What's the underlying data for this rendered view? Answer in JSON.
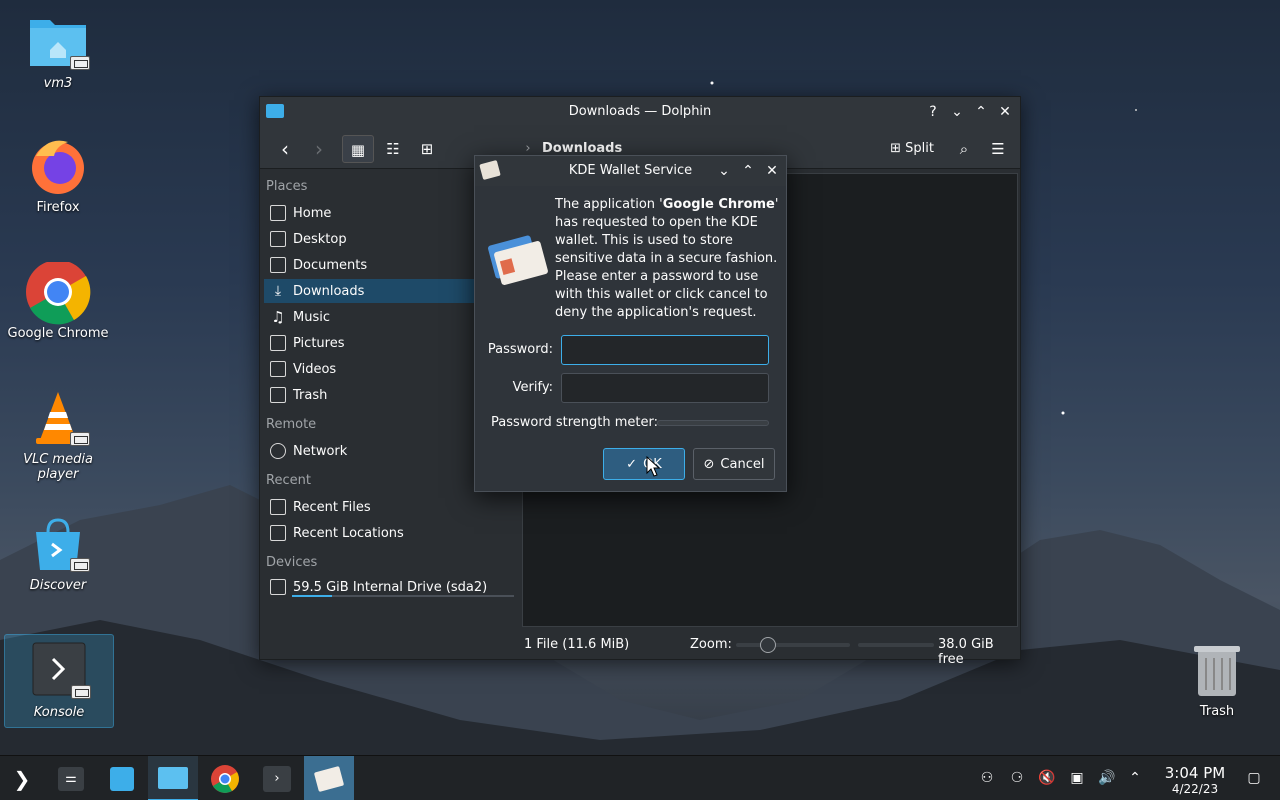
{
  "desktop": {
    "icons": [
      {
        "label": "vm3"
      },
      {
        "label": "Firefox"
      },
      {
        "label": "Google Chrome"
      },
      {
        "label": "VLC media player"
      },
      {
        "label": "Discover"
      },
      {
        "label": "Konsole"
      }
    ],
    "trash_label": "Trash"
  },
  "dolphin": {
    "title": "Downloads — Dolphin",
    "breadcrumb": "Downloads",
    "split_label": "Split",
    "sidebar": {
      "places_header": "Places",
      "places": [
        {
          "label": "Home",
          "icon": "home-icon"
        },
        {
          "label": "Desktop",
          "icon": "desktop-icon"
        },
        {
          "label": "Documents",
          "icon": "documents-icon"
        },
        {
          "label": "Downloads",
          "icon": "downloads-icon"
        },
        {
          "label": "Music",
          "icon": "music-icon"
        },
        {
          "label": "Pictures",
          "icon": "pictures-icon"
        },
        {
          "label": "Videos",
          "icon": "videos-icon"
        },
        {
          "label": "Trash",
          "icon": "trash-icon"
        }
      ],
      "remote_header": "Remote",
      "remote": [
        {
          "label": "Network",
          "icon": "network-icon"
        }
      ],
      "recent_header": "Recent",
      "recent": [
        {
          "label": "Recent Files",
          "icon": "recent-files-icon"
        },
        {
          "label": "Recent Locations",
          "icon": "recent-locations-icon"
        }
      ],
      "devices_header": "Devices",
      "devices": [
        {
          "label": "59.5 GiB Internal Drive (sda2)",
          "icon": "drive-icon"
        }
      ]
    },
    "status": {
      "file_count": "1 File (11.6 MiB)",
      "zoom_label": "Zoom:",
      "free_space": "38.0 GiB free"
    }
  },
  "wallet_dialog": {
    "title": "KDE Wallet Service",
    "message_prefix": "The application '",
    "app_name": "Google Chrome",
    "message_suffix": "' has requested to open the KDE wallet. This is used to store sensitive data in a secure fashion. Please enter a password to use with this wallet or click cancel to deny the application's request.",
    "password_label": "Password:",
    "verify_label": "Verify:",
    "strength_label": "Password strength meter:",
    "ok_label": "OK",
    "cancel_label": "Cancel"
  },
  "taskbar": {
    "time": "3:04 PM",
    "date": "4/22/23"
  },
  "colors": {
    "accent": "#3daee9",
    "window_bg": "#2a2e32",
    "selection": "#1e4a68"
  }
}
